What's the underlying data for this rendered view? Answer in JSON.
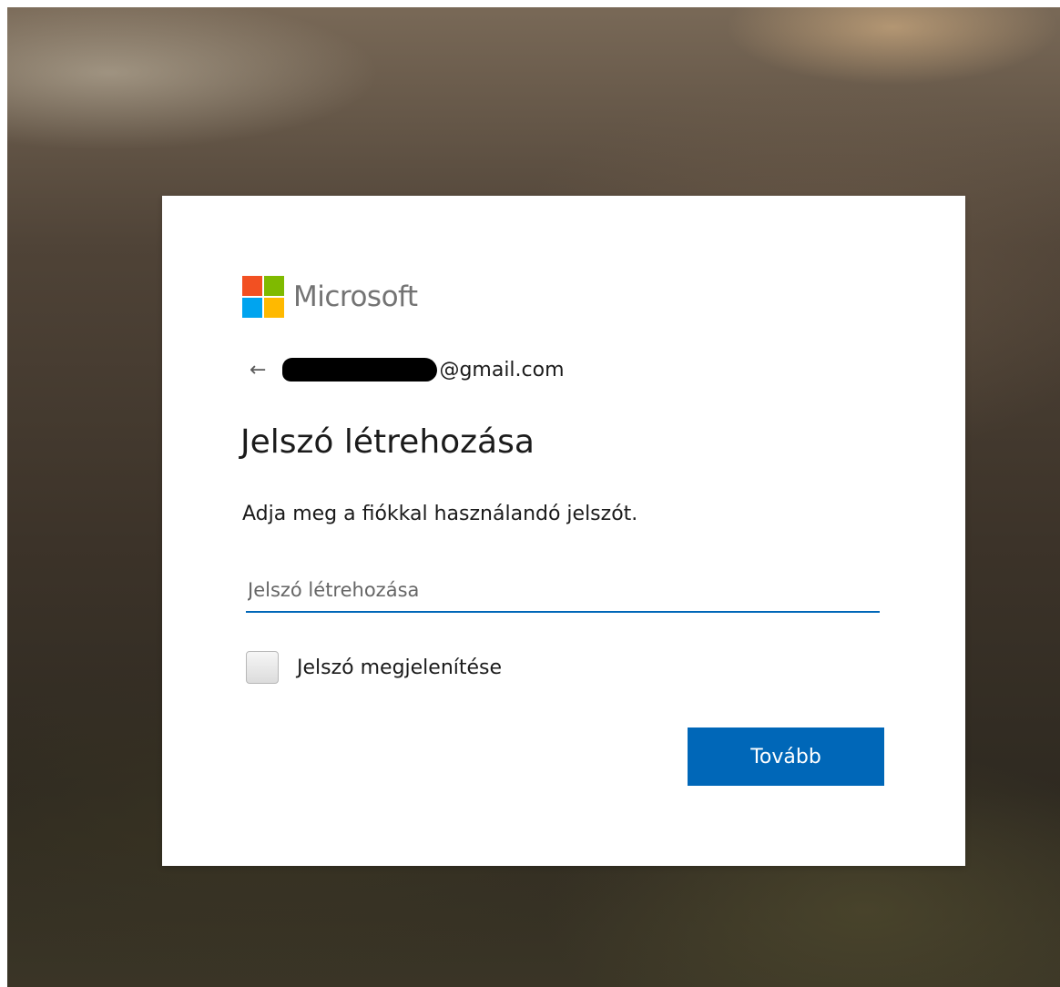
{
  "brand": {
    "name": "Microsoft",
    "logo_colors": [
      "#f25022",
      "#7fba00",
      "#00a4ef",
      "#ffb900"
    ]
  },
  "identity": {
    "back_icon": "arrow-left-icon",
    "back_glyph": "←",
    "email_visible": "@gmail.com"
  },
  "page": {
    "title": "Jelszó létrehozása",
    "description": "Adja meg a fiókkal használandó jelszót."
  },
  "password_field": {
    "placeholder": "Jelszó létrehozása",
    "value": ""
  },
  "show_password": {
    "label": "Jelszó megjelenítése",
    "checked": false
  },
  "actions": {
    "next_label": "Tovább",
    "accent_color": "#0067b8"
  }
}
